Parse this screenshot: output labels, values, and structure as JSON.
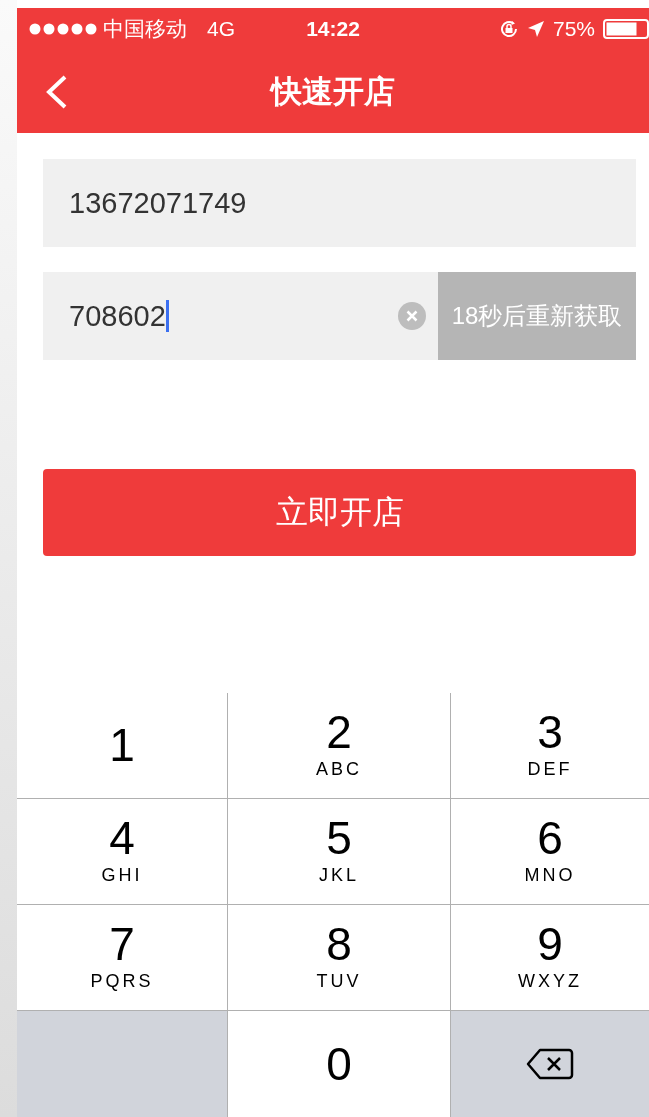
{
  "status_bar": {
    "carrier": "中国移动",
    "network": "4G",
    "time": "14:22",
    "battery": "75%"
  },
  "nav_bar": {
    "title": "快速开店"
  },
  "form": {
    "phone_field": {
      "value": "13672071749",
      "focused": false
    },
    "code_field": {
      "value": "708602",
      "focused": true
    },
    "resend_button": {
      "label": "18秒后重新获取",
      "disabled": true
    },
    "submit_button": {
      "label": "立即开店"
    }
  },
  "keypad": {
    "keys": [
      {
        "kind": "digit",
        "digit": "1"
      },
      {
        "kind": "digit",
        "digit": "2",
        "letters": "ABC"
      },
      {
        "kind": "digit",
        "digit": "3",
        "letters": "DEF"
      },
      {
        "kind": "digit",
        "digit": "4",
        "letters": "GHI"
      },
      {
        "kind": "digit",
        "digit": "5",
        "letters": "JKL"
      },
      {
        "kind": "digit",
        "digit": "6",
        "letters": "MNO"
      },
      {
        "kind": "digit",
        "digit": "7",
        "letters": "PQRS"
      },
      {
        "kind": "digit",
        "digit": "8",
        "letters": "TUV"
      },
      {
        "kind": "digit",
        "digit": "9",
        "letters": "WXYZ"
      },
      {
        "kind": "blank"
      },
      {
        "kind": "digit",
        "digit": "0"
      },
      {
        "kind": "delete"
      }
    ]
  }
}
